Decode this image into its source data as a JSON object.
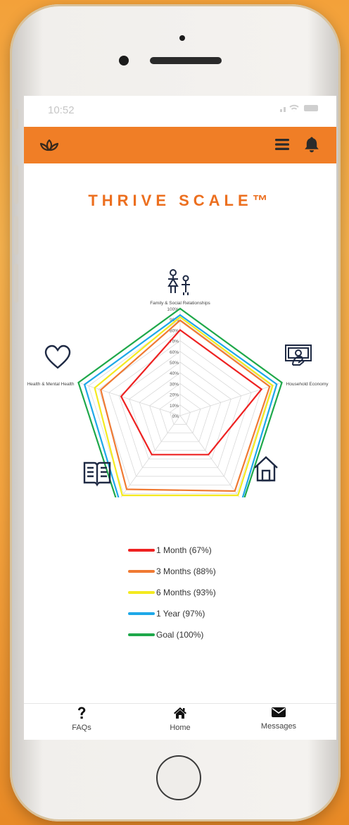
{
  "status_bar": {
    "time": "10:52"
  },
  "header": {
    "logo_icon": "lotus-icon",
    "menu_icon": "hamburger-menu-icon",
    "notification_icon": "bell-icon",
    "color": "#f07e26"
  },
  "page": {
    "title": "THRIVE SCALE™"
  },
  "chart_data": {
    "type": "radar",
    "axes": [
      "Family & Social Relationships",
      "Household Economy",
      "Living Conditions",
      "Education",
      "Health & Mental Health"
    ],
    "tick_labels": [
      "100%",
      "90%",
      "80%",
      "70%",
      "60%",
      "50%",
      "40%",
      "30%",
      "20%",
      "10%",
      "0%"
    ],
    "range": [
      0,
      100
    ],
    "series": [
      {
        "name": "1 Month (67%)",
        "color": "#ee2222",
        "values": [
          80,
          80,
          45,
          45,
          58
        ]
      },
      {
        "name": "3 Months (88%)",
        "color": "#f07a33",
        "values": [
          89,
          88,
          87,
          85,
          78
        ]
      },
      {
        "name": "6 Months (93%)",
        "color": "#f4ea20",
        "values": [
          92,
          91,
          92,
          92,
          84
        ]
      },
      {
        "name": "1 Year (97%)",
        "color": "#1ea8e8",
        "values": [
          94,
          95,
          98,
          97,
          94
        ]
      },
      {
        "name": "Goal (100%)",
        "color": "#1ea84a",
        "values": [
          100,
          100,
          100,
          100,
          100
        ]
      }
    ]
  },
  "tabs": [
    {
      "label": "FAQs",
      "icon": "question-mark-icon"
    },
    {
      "label": "Home",
      "icon": "home-icon"
    },
    {
      "label": "Messages",
      "icon": "envelope-icon"
    }
  ]
}
